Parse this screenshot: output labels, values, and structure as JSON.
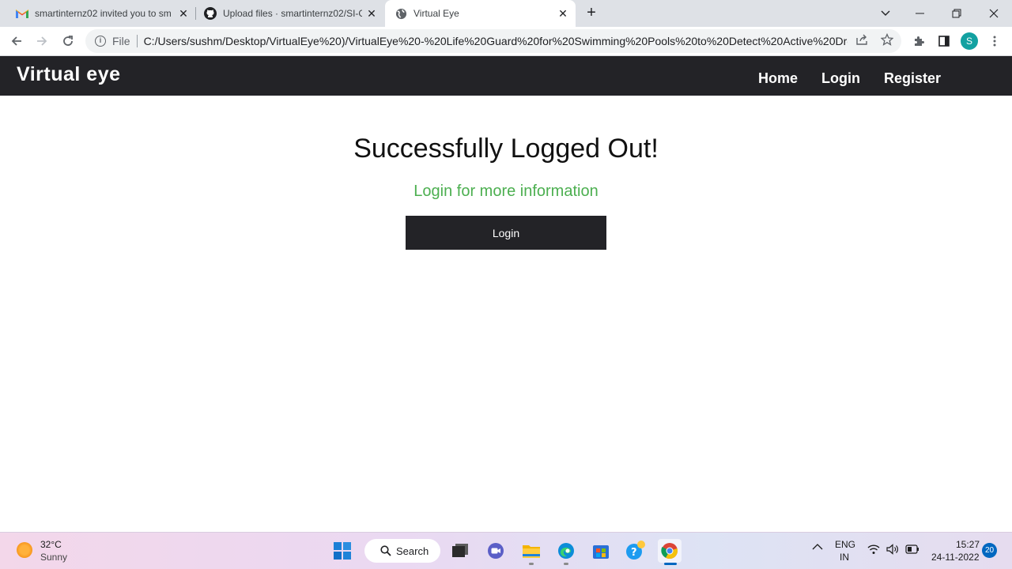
{
  "browser": {
    "tabs": [
      {
        "title": "smartinternz02 invited you to sm",
        "icon": "gmail-icon"
      },
      {
        "title": "Upload files · smartinternz02/SI-G",
        "icon": "github-icon"
      },
      {
        "title": "Virtual Eye",
        "icon": "globe-icon",
        "active": true
      }
    ],
    "new_tab": "+",
    "omnibox": {
      "scheme_label": "File",
      "url": "C:/Users/sushm/Desktop/VirtualEye%20)/VirtualEye%20-%20Life%20Guard%20for%20Swimming%20Pools%20to%20Detect%20Active%20Dro..."
    },
    "profile_initial": "S"
  },
  "site": {
    "brand": "Virtual eye",
    "nav": {
      "home": "Home",
      "login": "Login",
      "register": "Register"
    },
    "heading": "Successfully Logged Out!",
    "subheading": "Login for more information",
    "login_button": "Login",
    "colors": {
      "navbar": "#232327",
      "subheading": "#4caf50",
      "button": "#232327"
    }
  },
  "taskbar": {
    "weather": {
      "temp": "32°C",
      "condition": "Sunny"
    },
    "search_label": "Search",
    "tray": {
      "lang": "ENG",
      "region": "IN",
      "time": "15:27",
      "date": "24-11-2022",
      "notifications": "20"
    }
  }
}
